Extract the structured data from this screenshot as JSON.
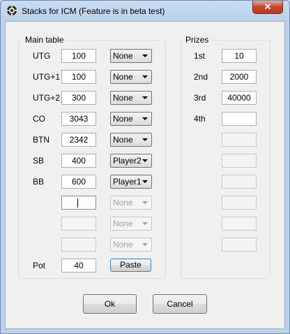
{
  "window": {
    "title": "Stacks for ICM (Feature is in beta test)",
    "close_label": "✕"
  },
  "main_table": {
    "legend": "Main table",
    "rows": [
      {
        "label": "UTG",
        "stack": "100",
        "player": "None"
      },
      {
        "label": "UTG+1",
        "stack": "100",
        "player": "None"
      },
      {
        "label": "UTG+2",
        "stack": "300",
        "player": "None"
      },
      {
        "label": "CO",
        "stack": "3043",
        "player": "None"
      },
      {
        "label": "BTN",
        "stack": "2342",
        "player": "None"
      },
      {
        "label": "SB",
        "stack": "400",
        "player": "Player2"
      },
      {
        "label": "BB",
        "stack": "600",
        "player": "Player1"
      },
      {
        "label": "",
        "stack": "",
        "player": "None"
      },
      {
        "label": "",
        "stack": "",
        "player": "None"
      },
      {
        "label": "",
        "stack": "",
        "player": "None"
      }
    ],
    "pot_label": "Pot",
    "pot_value": "40",
    "paste_label": "Paste"
  },
  "prizes": {
    "legend": "Prizes",
    "rows": [
      {
        "label": "1st",
        "value": "10"
      },
      {
        "label": "2nd",
        "value": "2000"
      },
      {
        "label": "3rd",
        "value": "40000"
      },
      {
        "label": "4th",
        "value": ""
      },
      {
        "label": "",
        "value": ""
      },
      {
        "label": "",
        "value": ""
      },
      {
        "label": "",
        "value": ""
      },
      {
        "label": "",
        "value": ""
      },
      {
        "label": "",
        "value": ""
      },
      {
        "label": "",
        "value": ""
      }
    ]
  },
  "buttons": {
    "ok_label": "Ok",
    "cancel_label": "Cancel"
  }
}
